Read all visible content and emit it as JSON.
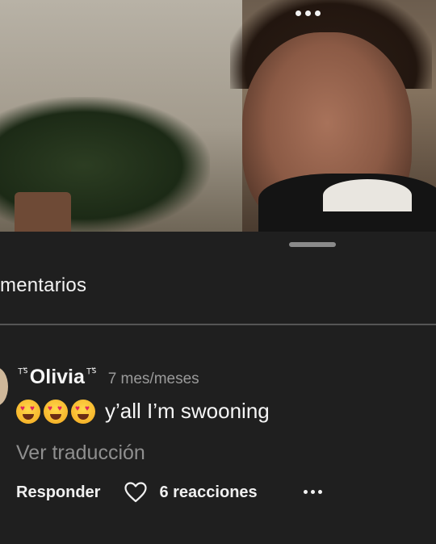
{
  "comments_sheet": {
    "title": "mentarios",
    "comment": {
      "author_decoration_left": "ᵀᔆ̈",
      "author_name": "Olivia",
      "author_decoration_right": "ᵀᔆ̈",
      "time_ago": "7 mes/meses",
      "emojis": [
        "smiling-face-with-heart-eyes",
        "smiling-face-with-heart-eyes",
        "smiling-face-with-heart-eyes"
      ],
      "text": "y’all I’m swooning",
      "translate_label": "Ver traducción",
      "reply_label": "Responder",
      "reactions_label": "6 reacciones"
    }
  },
  "colors": {
    "background": "#1f1f1f",
    "divider": "#555555",
    "muted_text": "#8f8f8f"
  }
}
